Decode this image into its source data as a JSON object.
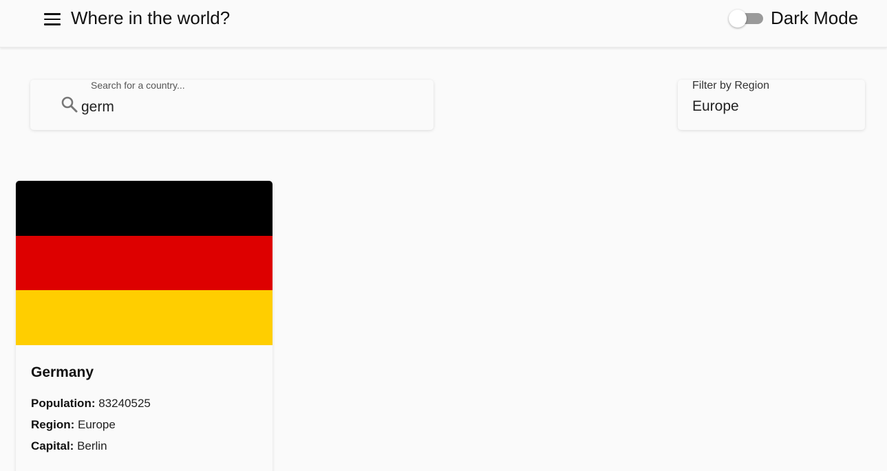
{
  "header": {
    "title": "Where in the world?",
    "menu_icon": "hamburger-menu-icon",
    "dark_mode_label": "Dark Mode",
    "dark_mode_enabled": false
  },
  "search": {
    "label": "Search for a country...",
    "value": "germ",
    "icon": "search-icon"
  },
  "filter": {
    "label": "Filter by Region",
    "value": "Europe"
  },
  "countries": [
    {
      "name": "Germany",
      "flag_colors": [
        "#000000",
        "#DD0000",
        "#FFCE00"
      ],
      "population_label": "Population:",
      "population": "83240525",
      "region_label": "Region:",
      "region": "Europe",
      "capital_label": "Capital:",
      "capital": "Berlin"
    }
  ]
}
